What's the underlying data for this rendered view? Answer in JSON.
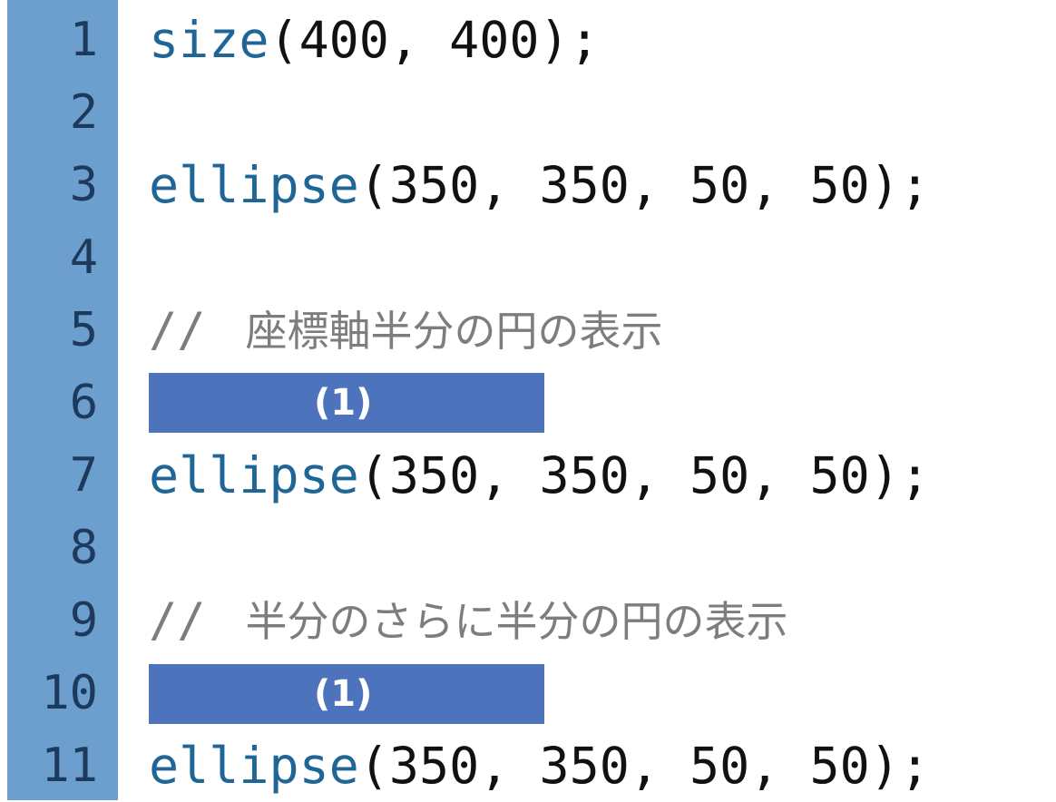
{
  "line_numbers": [
    "1",
    "2",
    "3",
    "4",
    "5",
    "6",
    "7",
    "8",
    "9",
    "10",
    "11"
  ],
  "code": {
    "line1": {
      "fn": "size",
      "args": "(400, 400);"
    },
    "line3": {
      "fn": "ellipse",
      "args": "(350, 350, 50, 50);"
    },
    "line5": {
      "slashes": "//",
      "text": "座標軸半分の円の表示"
    },
    "line6": {
      "blank_label": "(1)"
    },
    "line7": {
      "fn": "ellipse",
      "args": "(350, 350, 50, 50);"
    },
    "line9": {
      "slashes": "//",
      "text": "半分のさらに半分の円の表示"
    },
    "line10": {
      "blank_label": "(1)"
    },
    "line11": {
      "fn": "ellipse",
      "args": "(350, 350, 50, 50);"
    }
  },
  "colors": {
    "gutter": "#6c9fce",
    "line_number": "#1d3a5c",
    "function": "#1f6696",
    "comment": "#7d7d7d",
    "blank_box": "#4d73bd"
  }
}
